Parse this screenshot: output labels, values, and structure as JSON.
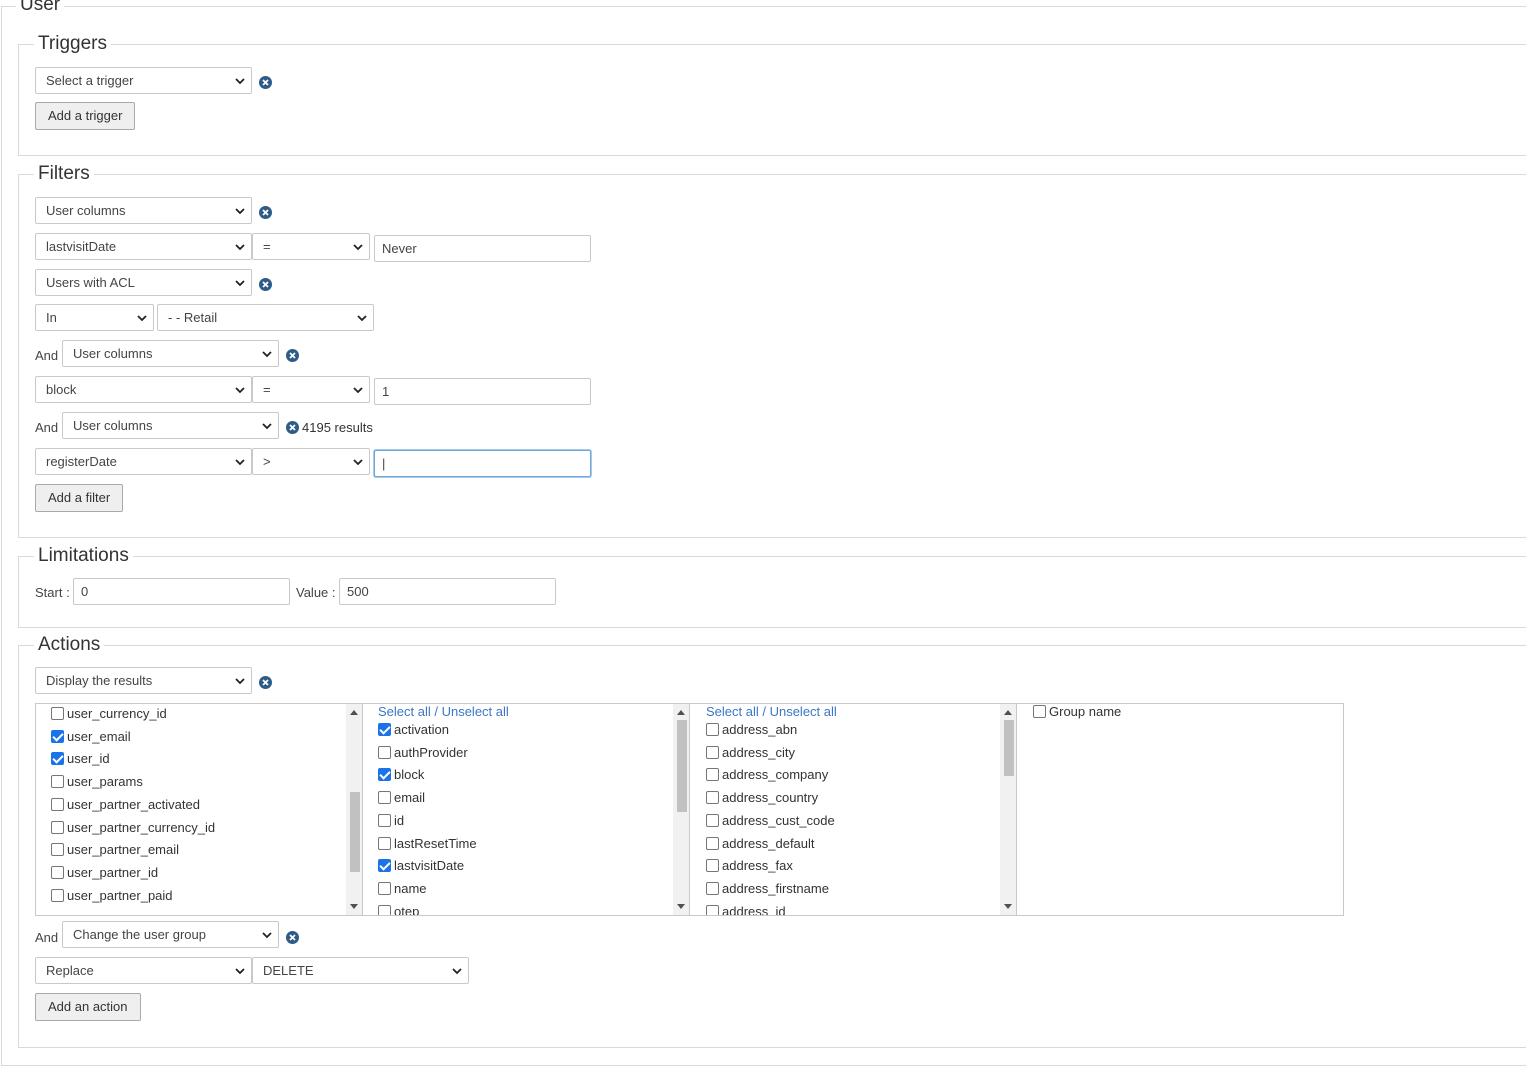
{
  "outer_legend": "User",
  "triggers": {
    "legend": "Triggers",
    "select_value": "Select a trigger",
    "add_button": "Add a trigger"
  },
  "filters": {
    "legend": "Filters",
    "f1": {
      "type": "User columns",
      "column": "lastvisitDate",
      "operator": "=",
      "value": "Never"
    },
    "f2": {
      "type": "Users with ACL",
      "mode": "In",
      "group": "- - Retail"
    },
    "f3": {
      "conjunction": "And",
      "type": "User columns",
      "column": "block",
      "operator": "=",
      "value": "1"
    },
    "f4": {
      "conjunction": "And",
      "type": "User columns",
      "results": "4195 results",
      "column": "registerDate",
      "operator": ">",
      "value": "|"
    },
    "add_button": "Add a filter"
  },
  "limitations": {
    "legend": "Limitations",
    "start_label": "Start :",
    "start_value": "0",
    "value_label": "Value :",
    "value_value": "500"
  },
  "actions": {
    "legend": "Actions",
    "display_select": "Display the results",
    "list1": [
      {
        "label": "user_currency_id",
        "checked": false
      },
      {
        "label": "user_email",
        "checked": true
      },
      {
        "label": "user_id",
        "checked": true
      },
      {
        "label": "user_params",
        "checked": false
      },
      {
        "label": "user_partner_activated",
        "checked": false
      },
      {
        "label": "user_partner_currency_id",
        "checked": false
      },
      {
        "label": "user_partner_email",
        "checked": false
      },
      {
        "label": "user_partner_id",
        "checked": false
      },
      {
        "label": "user_partner_paid",
        "checked": false
      }
    ],
    "list2_header": "Select all / Unselect all",
    "list2": [
      {
        "label": "activation",
        "checked": true
      },
      {
        "label": "authProvider",
        "checked": false
      },
      {
        "label": "block",
        "checked": true
      },
      {
        "label": "email",
        "checked": false
      },
      {
        "label": "id",
        "checked": false
      },
      {
        "label": "lastResetTime",
        "checked": false
      },
      {
        "label": "lastvisitDate",
        "checked": true
      },
      {
        "label": "name",
        "checked": false
      },
      {
        "label": "otep",
        "checked": false
      }
    ],
    "list3_header": "Select all / Unselect all",
    "list3": [
      {
        "label": "address_abn",
        "checked": false
      },
      {
        "label": "address_city",
        "checked": false
      },
      {
        "label": "address_company",
        "checked": false
      },
      {
        "label": "address_country",
        "checked": false
      },
      {
        "label": "address_cust_code",
        "checked": false
      },
      {
        "label": "address_default",
        "checked": false
      },
      {
        "label": "address_fax",
        "checked": false
      },
      {
        "label": "address_firstname",
        "checked": false
      },
      {
        "label": "address_id",
        "checked": false
      }
    ],
    "list4": [
      {
        "label": "Group name",
        "checked": false
      }
    ],
    "and_label": "And",
    "change_select": "Change the user group",
    "replace_select": "Replace",
    "group_select": "DELETE",
    "add_button": "Add an action"
  },
  "colors": {
    "accent": "#1a73e8",
    "link": "#3b77c6",
    "remove_icon": "#2e5b87"
  }
}
